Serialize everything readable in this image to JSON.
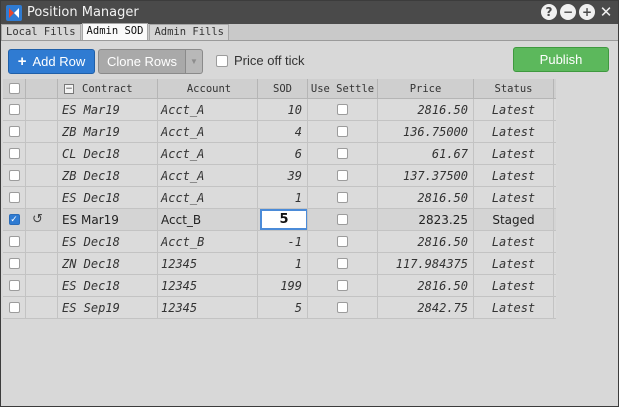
{
  "window": {
    "title": "Position Manager",
    "controls": {
      "help": "?",
      "minimize": "−",
      "maximize": "+",
      "close": "✕"
    }
  },
  "tabs": [
    {
      "label": "Local Fills",
      "active": false
    },
    {
      "label": "Admin SOD",
      "active": true
    },
    {
      "label": "Admin Fills",
      "active": false
    }
  ],
  "toolbar": {
    "add_row": "Add Row",
    "clone_rows": "Clone Rows",
    "clone_dropdown": "▼",
    "price_off_tick": "Price off tick",
    "publish": "Publish",
    "accent_color": "#2f7bd2",
    "publish_color": "#5cb85c"
  },
  "grid": {
    "columns": {
      "contract": "Contract",
      "account": "Account",
      "sod": "SOD",
      "use_settle": "Use Settle",
      "price": "Price",
      "status": "Status"
    },
    "collapse_icon": "−",
    "rows": [
      {
        "contract": "ES Mar19",
        "account": "Acct_A",
        "sod": "10",
        "price": "2816.50",
        "status": "Latest",
        "selected": false,
        "staged": false
      },
      {
        "contract": "ZB Mar19",
        "account": "Acct_A",
        "sod": "4",
        "price": "136.75000",
        "status": "Latest",
        "selected": false,
        "staged": false
      },
      {
        "contract": "CL Dec18",
        "account": "Acct_A",
        "sod": "6",
        "price": "61.67",
        "status": "Latest",
        "selected": false,
        "staged": false
      },
      {
        "contract": "ZB Dec18",
        "account": "Acct_A",
        "sod": "39",
        "price": "137.37500",
        "status": "Latest",
        "selected": false,
        "staged": false
      },
      {
        "contract": "ES Dec18",
        "account": "Acct_A",
        "sod": "1",
        "price": "2816.50",
        "status": "Latest",
        "selected": false,
        "staged": false
      },
      {
        "contract": "ES Mar19",
        "account": "Acct_B",
        "sod": "5",
        "price": "2823.25",
        "status": "Staged",
        "selected": true,
        "staged": true
      },
      {
        "contract": "ES Dec18",
        "account": "Acct_B",
        "sod": "-1",
        "price": "2816.50",
        "status": "Latest",
        "selected": false,
        "staged": false
      },
      {
        "contract": "ZN Dec18",
        "account": "12345",
        "sod": "1",
        "price": "117.984375",
        "status": "Latest",
        "selected": false,
        "staged": false
      },
      {
        "contract": "ES Dec18",
        "account": "12345",
        "sod": "199",
        "price": "2816.50",
        "status": "Latest",
        "selected": false,
        "staged": false
      },
      {
        "contract": "ES Sep19",
        "account": "12345",
        "sod": "5",
        "price": "2842.75",
        "status": "Latest",
        "selected": false,
        "staged": false
      }
    ]
  }
}
